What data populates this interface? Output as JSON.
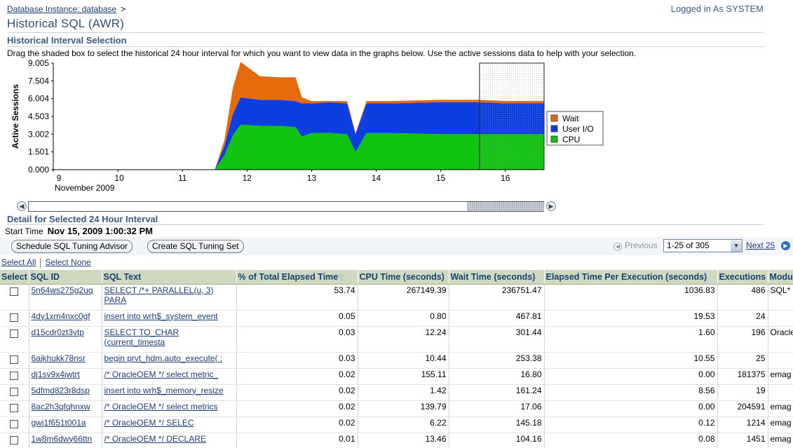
{
  "header": {
    "breadcrumb_link": "Database Instance: database",
    "breadcrumb_sep": ">",
    "login": "Logged in As SYSTEM",
    "title": "Historical SQL (AWR)"
  },
  "interval_section": {
    "heading": "Historical Interval Selection",
    "instructions": "Drag the shaded box to select the historical 24 hour interval for which you want to view data in the graphs below. Use the active sessions data to help with your selection."
  },
  "chart_data": {
    "type": "area",
    "stacked": true,
    "ylabel": "Active Sessions",
    "ylim": [
      0,
      9.005
    ],
    "yticks": [
      "0.000",
      "1.501",
      "3.002",
      "4.503",
      "6.004",
      "7.504",
      "9.005"
    ],
    "xticks": [
      "9",
      "10",
      "11",
      "12",
      "13",
      "14",
      "15",
      "16"
    ],
    "xsub": "November 2009",
    "xlim": [
      9,
      16.6
    ],
    "x": [
      9,
      11.5,
      11.65,
      11.78,
      11.9,
      12.2,
      12.5,
      12.75,
      12.85,
      13.0,
      13.3,
      13.55,
      13.68,
      13.85,
      14.2,
      15.0,
      15.6,
      16.0,
      16.6
    ],
    "series": [
      {
        "name": "CPU",
        "color": "#11c411",
        "values": [
          0,
          0,
          1.2,
          2.9,
          3.8,
          3.7,
          3.7,
          3.6,
          2.8,
          3.1,
          3.1,
          3.0,
          1.5,
          3.1,
          3.1,
          3.0,
          3.0,
          3.0,
          3.0
        ]
      },
      {
        "name": "User I/O",
        "color": "#0d3fe0",
        "values": [
          0,
          0,
          0.8,
          1.8,
          2.3,
          2.2,
          2.2,
          2.2,
          2.8,
          2.5,
          2.6,
          2.6,
          1.5,
          2.5,
          2.5,
          2.7,
          2.7,
          2.6,
          2.6
        ]
      },
      {
        "name": "Wait",
        "color": "#e46a0c",
        "values": [
          0,
          0,
          0.5,
          2.2,
          3.0,
          2.0,
          1.9,
          2.0,
          0.5,
          0.2,
          0.1,
          0.2,
          0.1,
          0.2,
          0.2,
          0.2,
          0.2,
          0.2,
          0.2
        ]
      }
    ],
    "legend": [
      "Wait",
      "User I/O",
      "CPU"
    ],
    "legend_position": "right",
    "selection": [
      15.6,
      16.6
    ]
  },
  "scroller": {
    "left_icon": "scroll-left-icon",
    "right_icon": "scroll-right-icon"
  },
  "detail_section": {
    "heading": "Detail for Selected 24 Hour Interval",
    "start_time_label": "Start Time",
    "start_time_value": "Nov 15, 2009 1:00:32 PM"
  },
  "toolbar": {
    "schedule_label": "Schedule SQL Tuning Advisor",
    "create_label": "Create SQL Tuning Set",
    "previous_label": "Previous",
    "range_value": "1-25 of 305",
    "next_label": "Next 25"
  },
  "select_links": {
    "all": "Select All",
    "none": "Select None"
  },
  "table": {
    "headers": [
      "Select",
      "SQL ID",
      "SQL Text",
      "% of Total Elapsed Time",
      "CPU Time (seconds)",
      "Wait Time (seconds)",
      "Elapsed Time Per Execution (seconds)",
      "Executions",
      "Modu"
    ],
    "rows": [
      {
        "sql_id": "5n64ws275g2uq",
        "sql_text": "SELECT /*+ PARALLEL(u, 3) PARA",
        "pct": "53.74",
        "cpu": "267149.39",
        "wait": "236751.47",
        "per_exec": "1036.83",
        "execs": "486",
        "module": "SQL*",
        "tall": true
      },
      {
        "sql_id": "4dy1xm4nxc0gf",
        "sql_text": "insert into wrh$_system_event",
        "pct": "0.05",
        "cpu": "0.80",
        "wait": "467.81",
        "per_exec": "19.53",
        "execs": "24",
        "module": "",
        "tall": false
      },
      {
        "sql_id": "d15cdr0zt3vtp",
        "sql_text": "SELECT TO_CHAR (current_timesta",
        "pct": "0.03",
        "cpu": "12.24",
        "wait": "301.44",
        "per_exec": "1.60",
        "execs": "196",
        "module": "Oracle Mana",
        "tall": true
      },
      {
        "sql_id": "6ajkhukk78nsr",
        "sql_text": "begin prvt_hdm.auto_execute( :",
        "pct": "0.03",
        "cpu": "10.44",
        "wait": "253.38",
        "per_exec": "10.55",
        "execs": "25",
        "module": "",
        "tall": false
      },
      {
        "sql_id": "dj1sv9x4jwtrt",
        "sql_text": "/* OracleOEM */ select metric_",
        "pct": "0.02",
        "cpu": "155.11",
        "wait": "16.80",
        "per_exec": "0.00",
        "execs": "181375",
        "module": "emag",
        "tall": false
      },
      {
        "sql_id": "5dfmd823r8dsp",
        "sql_text": "insert into wrh$_memory_resize",
        "pct": "0.02",
        "cpu": "1.42",
        "wait": "161.24",
        "per_exec": "8.56",
        "execs": "19",
        "module": "",
        "tall": false
      },
      {
        "sql_id": "8ac2h3qfqhnxw",
        "sql_text": "/* OracleOEM */ select metrics",
        "pct": "0.02",
        "cpu": "139.79",
        "wait": "17.06",
        "per_exec": "0.00",
        "execs": "204591",
        "module": "emag",
        "tall": false
      },
      {
        "sql_id": "gwj1f651t001a",
        "sql_text": "/* OracleOEM */ SELEC",
        "pct": "0.02",
        "cpu": "6.22",
        "wait": "145.18",
        "per_exec": "0.12",
        "execs": "1214",
        "module": "emag",
        "tall": false
      },
      {
        "sql_id": "1w8m6dwy66ttn",
        "sql_text": "/* OracleOEM */ DECLARE",
        "pct": "0.01",
        "cpu": "13.46",
        "wait": "104.16",
        "per_exec": "0.08",
        "execs": "1451",
        "module": "emag",
        "tall": false
      }
    ]
  }
}
